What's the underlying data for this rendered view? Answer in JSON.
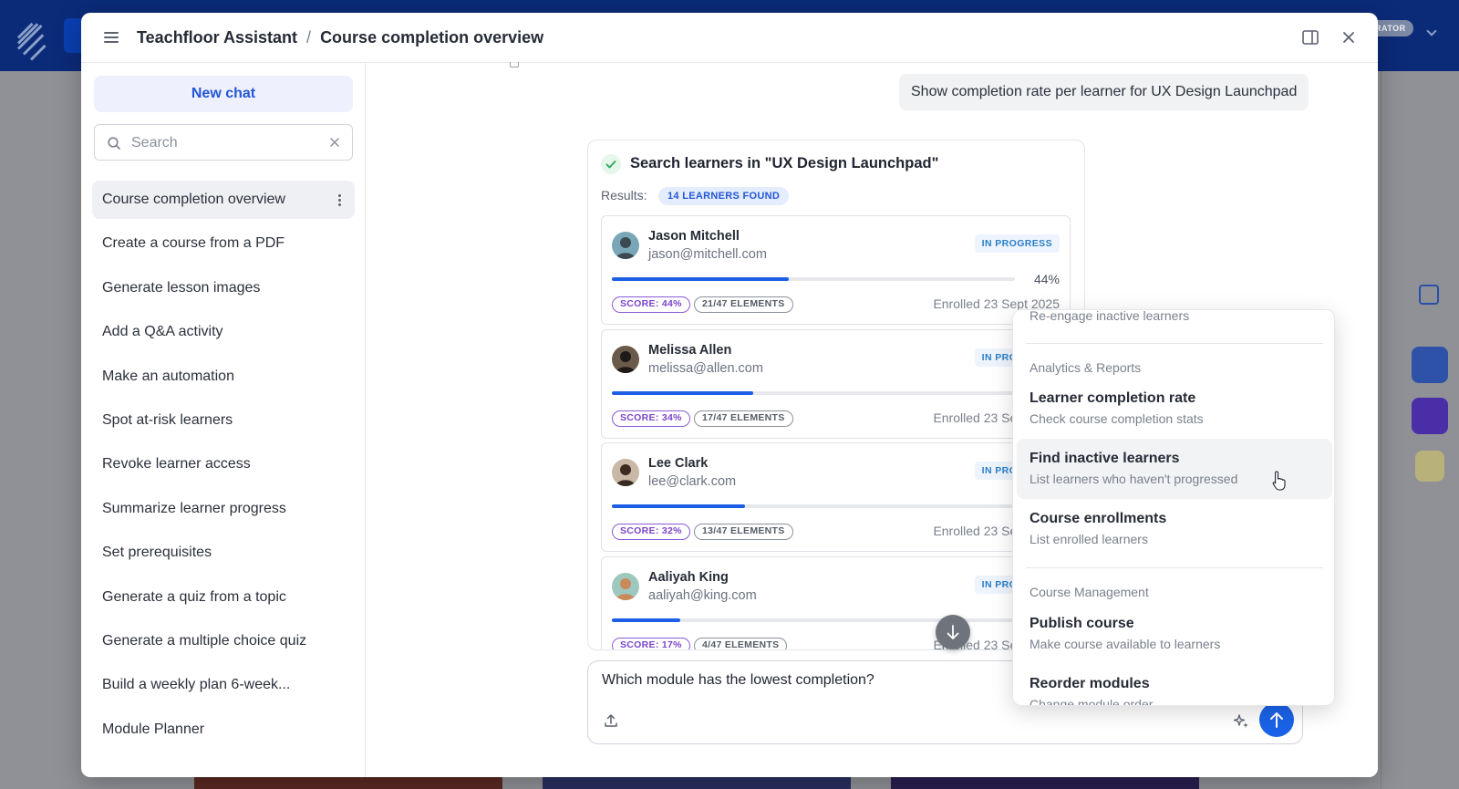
{
  "background": {
    "badge": "RATOR"
  },
  "header": {
    "app_title": "Teachfloor Assistant",
    "separator": "/",
    "page_title": "Course completion overview"
  },
  "sidebar": {
    "new_chat_label": "New chat",
    "search_placeholder": "Search",
    "items": [
      {
        "label": "Course completion overview",
        "active": true
      },
      {
        "label": "Create a course from a PDF"
      },
      {
        "label": "Generate lesson images"
      },
      {
        "label": "Add a Q&A activity"
      },
      {
        "label": "Make an automation"
      },
      {
        "label": "Spot at-risk learners"
      },
      {
        "label": "Revoke learner access"
      },
      {
        "label": "Summarize learner progress"
      },
      {
        "label": "Set prerequisites"
      },
      {
        "label": "Generate a quiz from a topic"
      },
      {
        "label": "Generate a multiple choice quiz"
      },
      {
        "label": "Build a weekly plan 6-week..."
      },
      {
        "label": "Module Planner"
      }
    ]
  },
  "conversation": {
    "user_message": "Show completion rate per learner for UX Design Launchpad",
    "tool_card": {
      "title": "Search learners in \"UX Design Launchpad\"",
      "results_label": "Results:",
      "results_badge": "14 LEARNERS FOUND",
      "learners": [
        {
          "name": "Jason Mitchell",
          "email": "jason@mitchell.com",
          "status": "IN PROGRESS",
          "progress": 0.44,
          "progress_label": "44%",
          "score": "SCORE: 44%",
          "elements": "21/47 ELEMENTS",
          "enrolled": "Enrolled 23 Sept 2025"
        },
        {
          "name": "Melissa Allen",
          "email": "melissa@allen.com",
          "status": "IN PROGRESS",
          "progress": 0.35,
          "progress_label": "35%",
          "score": "SCORE: 34%",
          "elements": "17/47 ELEMENTS",
          "enrolled": "Enrolled 23 Sept 2025"
        },
        {
          "name": "Lee Clark",
          "email": "lee@clark.com",
          "status": "IN PROGRESS",
          "progress": 0.33,
          "progress_label": "33%",
          "score": "SCORE: 32%",
          "elements": "13/47 ELEMENTS",
          "enrolled": "Enrolled 23 Sept 2025"
        },
        {
          "name": "Aaliyah King",
          "email": "aaliyah@king.com",
          "status": "IN PROGRESS",
          "progress": 0.17,
          "progress_label": "17%",
          "score": "SCORE: 17%",
          "elements": "4/47 ELEMENTS",
          "enrolled": "Enrolled 23 Sept 2023"
        }
      ]
    }
  },
  "composer": {
    "value": "Which module has the lowest completion?"
  },
  "dropdown": {
    "top_partial": "Re-engage inactive learners",
    "sections": [
      {
        "heading": "Analytics & Reports",
        "items": [
          {
            "title": "Learner completion rate",
            "desc": "Check course completion stats"
          },
          {
            "title": "Find inactive learners",
            "desc": "List learners who haven't progressed",
            "hovered": true
          },
          {
            "title": "Course enrollments",
            "desc": "List enrolled learners"
          }
        ]
      },
      {
        "heading": "Course Management",
        "items": [
          {
            "title": "Publish course",
            "desc": "Make course available to learners"
          },
          {
            "title": "Reorder modules",
            "desc": "Change module order"
          }
        ]
      }
    ]
  },
  "colors": {
    "accent": "#1a63e8",
    "progress_bar": "#1d5ee6",
    "score_purple": "#7a44c9",
    "status_blue": "#2a7fc7"
  }
}
